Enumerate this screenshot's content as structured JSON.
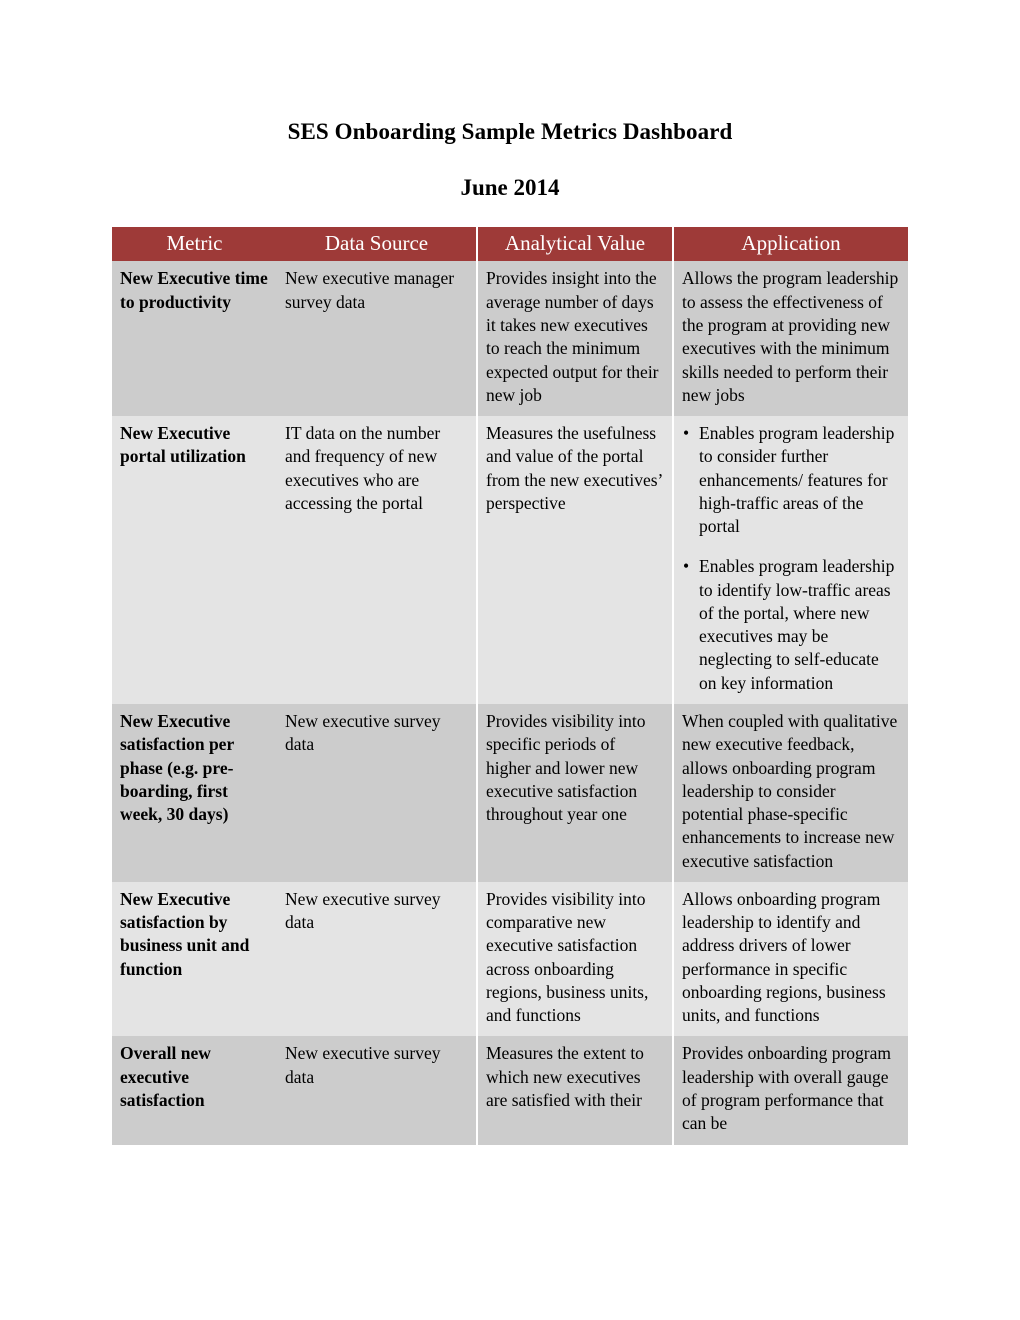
{
  "document": {
    "title": "SES Onboarding Sample Metrics Dashboard",
    "subtitle": "June 2014"
  },
  "colors": {
    "header_background": "#9E3A38",
    "header_text": "#FFFFFF",
    "row_shade_dark": "#CCCCCC",
    "row_shade_light": "#E4E4E4",
    "page_background": "#FFFFFF",
    "body_text": "#000000"
  },
  "table": {
    "columns": [
      {
        "key": "metric",
        "label": "Metric"
      },
      {
        "key": "data_source",
        "label": "Data Source"
      },
      {
        "key": "analytical_value",
        "label": "Analytical Value"
      },
      {
        "key": "application",
        "label": "Application"
      }
    ],
    "rows": [
      {
        "shade": "dark",
        "metric": "New Executive time to productivity",
        "data_source": "New executive manager survey data",
        "analytical_value": "Provides insight into the average number of days it takes new executives to reach the minimum expected output for their new job",
        "application": "Allows the program leadership to assess the effectiveness of the program at providing new executives with the minimum skills needed to perform their new jobs",
        "application_bullets": []
      },
      {
        "shade": "light",
        "metric": "New Executive portal utilization",
        "data_source": "IT data on the number and frequency of new executives who are accessing the portal",
        "analytical_value": "Measures the usefulness and value of the portal from the new executives’ perspective",
        "application": "",
        "application_bullets": [
          "Enables program leadership to consider further enhancements/ features for high-traffic areas of the portal",
          "Enables program leadership to identify low-traffic areas of the portal, where new executives may be neglecting to self-educate on key information"
        ]
      },
      {
        "shade": "dark",
        "metric": "New Executive satisfaction per phase (e.g. pre-boarding, first week, 30 days)",
        "data_source": "New executive survey data",
        "analytical_value": "Provides visibility into specific periods of higher and lower new executive satisfaction throughout year one",
        "application": "When coupled with qualitative new executive feedback, allows onboarding program leadership to consider potential phase-specific enhancements to increase new executive satisfaction",
        "application_bullets": []
      },
      {
        "shade": "light",
        "metric": "New Executive satisfaction by business unit and function",
        "data_source": "New executive survey data",
        "analytical_value": "Provides visibility into comparative new executive satisfaction across onboarding regions, business units, and functions",
        "application": "Allows onboarding program leadership to identify and address drivers of lower performance in specific onboarding regions, business units, and functions",
        "application_bullets": []
      },
      {
        "shade": "dark",
        "metric": "Overall new executive satisfaction",
        "data_source": "New executive survey data",
        "analytical_value": "Measures the extent to which new executives are satisfied with their",
        "application": "Provides onboarding program leadership with overall gauge of program performance that can be",
        "application_bullets": []
      }
    ]
  }
}
